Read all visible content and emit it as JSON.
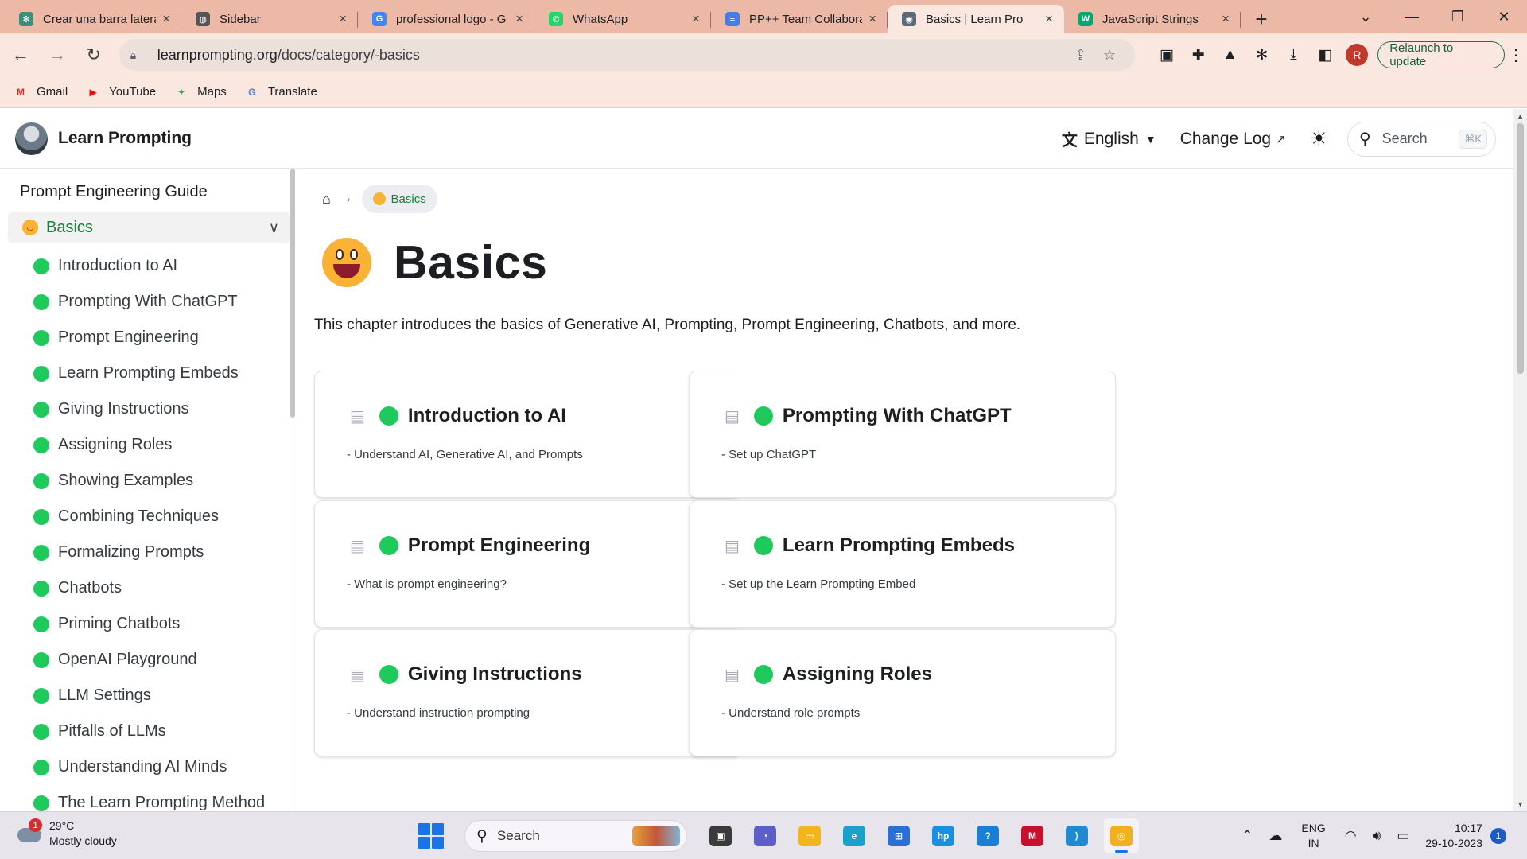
{
  "browser": {
    "tabs": [
      {
        "title": "Crear una barra lateral",
        "icon": "chatgpt-icon",
        "color": "#3d8f7a",
        "glyph": "✻",
        "active": false
      },
      {
        "title": "Sidebar",
        "icon": "globe-icon",
        "color": "#555555",
        "glyph": "◍",
        "active": false
      },
      {
        "title": "professional logo - G",
        "icon": "google-icon",
        "color": "#4285f4",
        "glyph": "G",
        "active": false
      },
      {
        "title": "WhatsApp",
        "icon": "whatsapp-icon",
        "color": "#25d366",
        "glyph": "✆",
        "active": false
      },
      {
        "title": "PP++ Team Collabora",
        "icon": "docs-icon",
        "color": "#4a7be0",
        "glyph": "≡",
        "active": false
      },
      {
        "title": "Basics | Learn Pro",
        "icon": "learnprompting-icon",
        "color": "#5a6a78",
        "glyph": "◉",
        "active": true
      },
      {
        "title": "JavaScript Strings",
        "icon": "w3schools-icon",
        "color": "#04aa6d",
        "glyph": "W",
        "active": false
      }
    ],
    "new_tab_label": "+",
    "url_host": "learnprompting.org",
    "url_path": "/docs/category/-basics",
    "relaunch_label": "Relaunch to update",
    "profile_initial": "R",
    "bookmarks": [
      {
        "label": "Gmail",
        "icon": "gmail-icon",
        "color": "#d93025",
        "glyph": "M"
      },
      {
        "label": "YouTube",
        "icon": "youtube-icon",
        "color": "#ff0000",
        "glyph": "▶"
      },
      {
        "label": "Maps",
        "icon": "maps-icon",
        "color": "#34a853",
        "glyph": "✦"
      },
      {
        "label": "Translate",
        "icon": "translate-icon",
        "color": "#4285f4",
        "glyph": "G"
      }
    ]
  },
  "site": {
    "logo_text": "Learn Prompting",
    "language": "English",
    "changelog": "Change Log",
    "search_placeholder": "Search",
    "search_shortcut": "⌘K"
  },
  "sidebar": {
    "title": "Prompt Engineering Guide",
    "category": "Basics",
    "items": [
      "Introduction to AI",
      "Prompting With ChatGPT",
      "Prompt Engineering",
      "Learn Prompting Embeds",
      "Giving Instructions",
      "Assigning Roles",
      "Showing Examples",
      "Combining Techniques",
      "Formalizing Prompts",
      "Chatbots",
      "Priming Chatbots",
      "OpenAI Playground",
      "LLM Settings",
      "Pitfalls of LLMs",
      "Understanding AI Minds",
      "The Learn Prompting Method"
    ]
  },
  "main": {
    "breadcrumb": "Basics",
    "title": "Basics",
    "intro": "This chapter introduces the basics of Generative AI, Prompting, Prompt Engineering, Chatbots, and more.",
    "cards": [
      {
        "title": "Introduction to AI",
        "desc": "- Understand AI, Generative AI, and Prompts"
      },
      {
        "title": "Prompting With ChatGPT",
        "desc": "- Set up ChatGPT"
      },
      {
        "title": "Prompt Engineering",
        "desc": "- What is prompt engineering?"
      },
      {
        "title": "Learn Prompting Embeds",
        "desc": "- Set up the Learn Prompting Embed"
      },
      {
        "title": "Giving Instructions",
        "desc": "- Understand instruction prompting"
      },
      {
        "title": "Assigning Roles",
        "desc": "- Understand role prompts"
      }
    ]
  },
  "taskbar": {
    "weather_temp": "29°C",
    "weather_desc": "Mostly cloudy",
    "weather_badge": "1",
    "search_label": "Search",
    "lang_top": "ENG",
    "lang_bottom": "IN",
    "time": "10:17",
    "date": "29-10-2023",
    "notifications": "1",
    "apps": [
      {
        "name": "task-view-icon",
        "color": "#3b3b3b",
        "glyph": "▣",
        "active": false
      },
      {
        "name": "teams-chat-icon",
        "color": "#5b5fc7",
        "glyph": "◔",
        "active": false
      },
      {
        "name": "file-explorer-icon",
        "color": "#f2b51c",
        "glyph": "▭",
        "active": false
      },
      {
        "name": "edge-icon",
        "color": "#1aa0c9",
        "glyph": "e",
        "active": false
      },
      {
        "name": "store-icon",
        "color": "#2b6fd6",
        "glyph": "⊞",
        "active": false
      },
      {
        "name": "myhp-icon",
        "color": "#1a8fe0",
        "glyph": "hp",
        "active": false
      },
      {
        "name": "help-icon",
        "color": "#1a7fd4",
        "glyph": "?",
        "active": false
      },
      {
        "name": "mcafee-icon",
        "color": "#c8102e",
        "glyph": "M",
        "active": false
      },
      {
        "name": "vscode-icon",
        "color": "#1f8ad2",
        "glyph": "⟩",
        "active": false
      },
      {
        "name": "chrome-icon",
        "color": "#f2b01e",
        "glyph": "◎",
        "active": true
      }
    ]
  }
}
